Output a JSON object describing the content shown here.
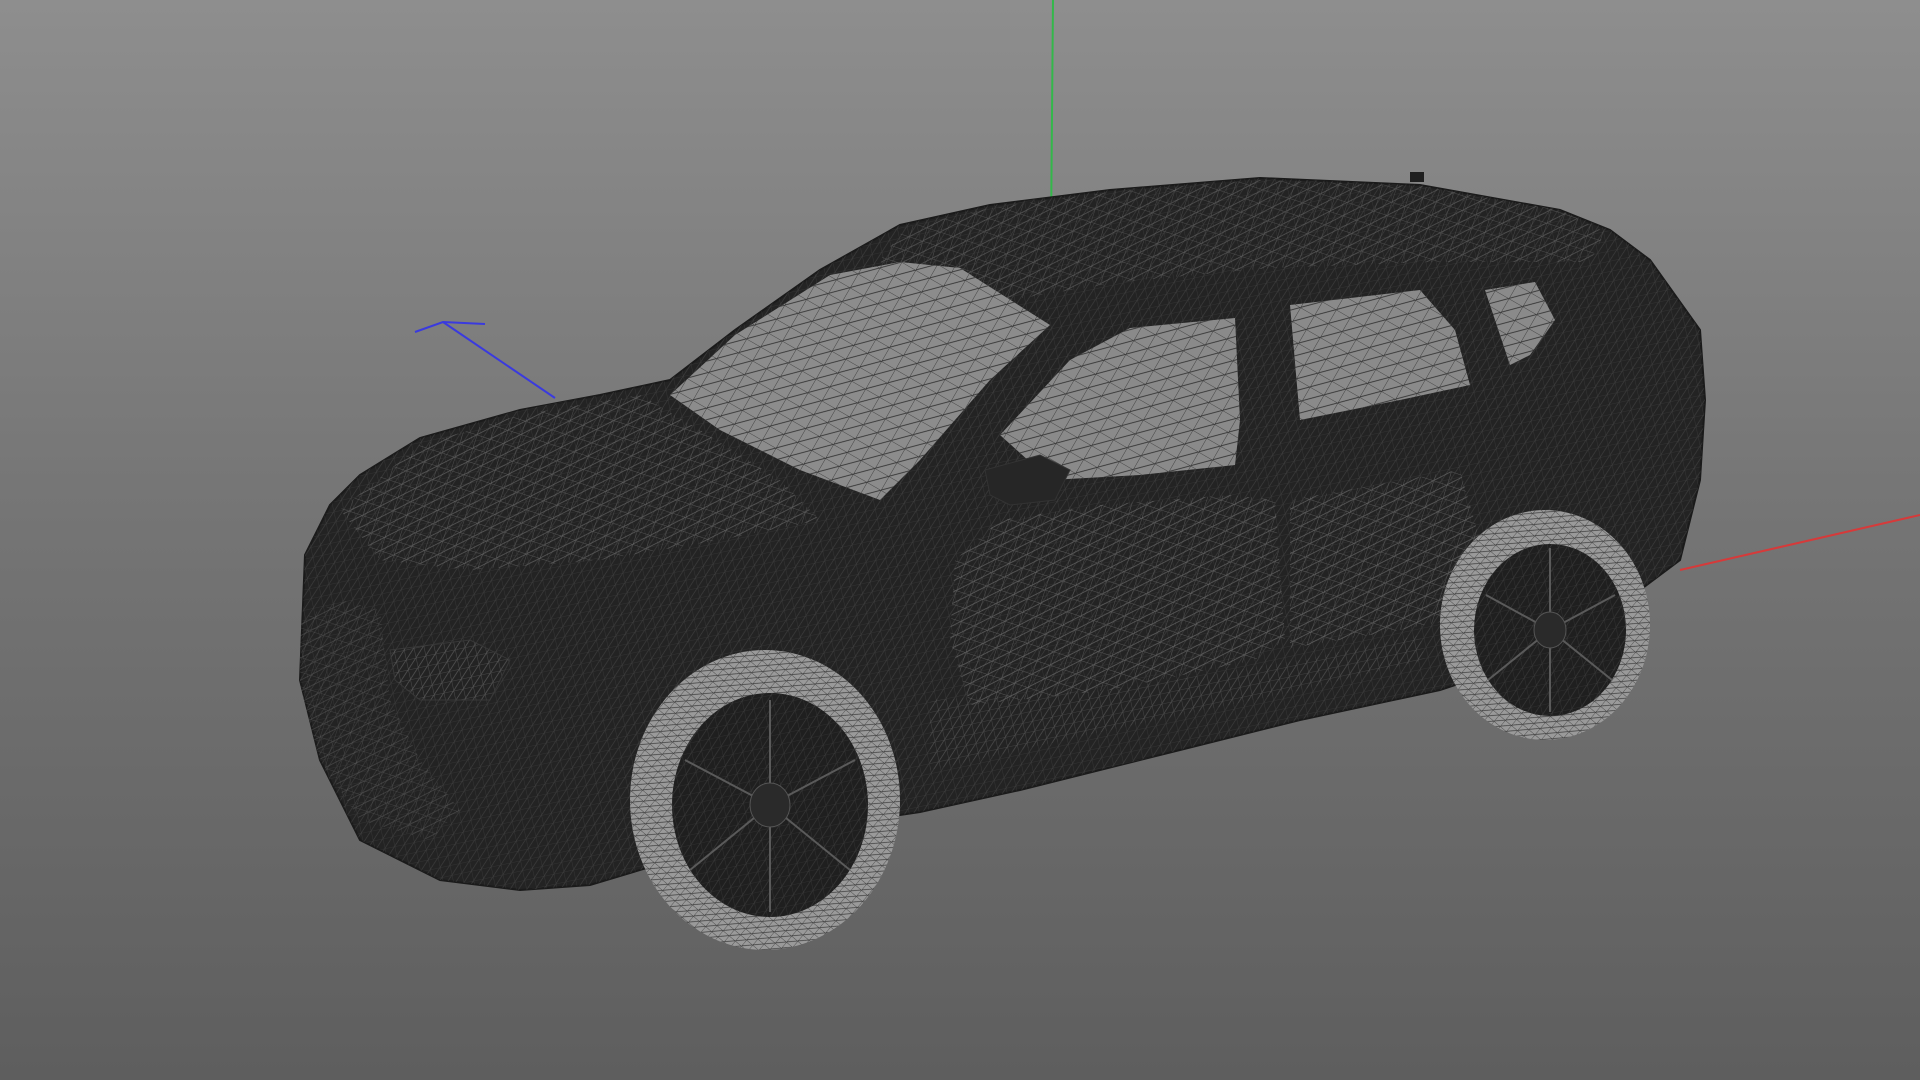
{
  "viewport": {
    "view": "3d-perspective",
    "render_mode": "wireframe",
    "background_gradient": [
      "#8e8e8e",
      "#5e5e5e"
    ],
    "axes": {
      "x": {
        "color": "#d63a3a"
      },
      "y": {
        "color": "#33b84a"
      },
      "z": {
        "color": "#3a3adf"
      }
    },
    "model": {
      "name": "suv-car",
      "body_color": "#232323",
      "wire_color": "#7c7c7c",
      "wheels": 4
    }
  }
}
